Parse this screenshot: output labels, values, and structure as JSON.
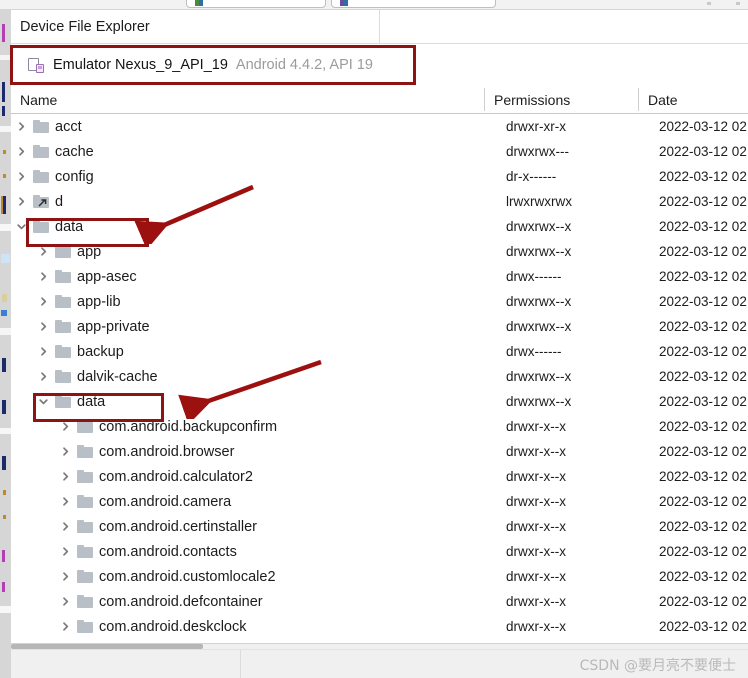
{
  "toolbar": {
    "combo_left_icon": "run-config-icon",
    "combo_right_icon": "device-select-icon"
  },
  "panel": {
    "title": "Device File Explorer"
  },
  "device": {
    "icon": "android-device-icon",
    "name": "Emulator Nexus_9_API_19",
    "details": "Android 4.4.2, API 19"
  },
  "columns": {
    "name": "Name",
    "permissions": "Permissions",
    "date": "Date"
  },
  "annotations": {
    "highlight_color": "#8f1313",
    "arrow_color": "#9d1010",
    "boxed_rows": [
      "data",
      "data"
    ]
  },
  "footer": {
    "watermark": "CSDN @要月亮不要便士"
  },
  "rows": [
    {
      "name": "acct",
      "indent": 0,
      "state": "collapsed",
      "icon": "folder-icon",
      "permissions": "drwxr-xr-x",
      "date": "2022-03-12 02"
    },
    {
      "name": "cache",
      "indent": 0,
      "state": "collapsed",
      "icon": "folder-icon",
      "permissions": "drwxrwx---",
      "date": "2022-03-12 02"
    },
    {
      "name": "config",
      "indent": 0,
      "state": "collapsed",
      "icon": "folder-icon",
      "permissions": "dr-x------",
      "date": "2022-03-12 02"
    },
    {
      "name": "d",
      "indent": 0,
      "state": "collapsed",
      "icon": "folder-link-icon",
      "permissions": "lrwxrwxrwx",
      "date": "2022-03-12 02"
    },
    {
      "name": "data",
      "indent": 0,
      "state": "expanded",
      "icon": "folder-icon",
      "permissions": "drwxrwx--x",
      "date": "2022-03-12 02"
    },
    {
      "name": "app",
      "indent": 1,
      "state": "collapsed",
      "icon": "folder-icon",
      "permissions": "drwxrwx--x",
      "date": "2022-03-12 02"
    },
    {
      "name": "app-asec",
      "indent": 1,
      "state": "collapsed",
      "icon": "folder-icon",
      "permissions": "drwx------",
      "date": "2022-03-12 02"
    },
    {
      "name": "app-lib",
      "indent": 1,
      "state": "collapsed",
      "icon": "folder-icon",
      "permissions": "drwxrwx--x",
      "date": "2022-03-12 02"
    },
    {
      "name": "app-private",
      "indent": 1,
      "state": "collapsed",
      "icon": "folder-icon",
      "permissions": "drwxrwx--x",
      "date": "2022-03-12 02"
    },
    {
      "name": "backup",
      "indent": 1,
      "state": "collapsed",
      "icon": "folder-icon",
      "permissions": "drwx------",
      "date": "2022-03-12 02"
    },
    {
      "name": "dalvik-cache",
      "indent": 1,
      "state": "collapsed",
      "icon": "folder-icon",
      "permissions": "drwxrwx--x",
      "date": "2022-03-12 02"
    },
    {
      "name": "data",
      "indent": 1,
      "state": "expanded",
      "icon": "folder-icon",
      "permissions": "drwxrwx--x",
      "date": "2022-03-12 02"
    },
    {
      "name": "com.android.backupconfirm",
      "indent": 2,
      "state": "collapsed",
      "icon": "folder-icon",
      "permissions": "drwxr-x--x",
      "date": "2022-03-12 02"
    },
    {
      "name": "com.android.browser",
      "indent": 2,
      "state": "collapsed",
      "icon": "folder-icon",
      "permissions": "drwxr-x--x",
      "date": "2022-03-12 02"
    },
    {
      "name": "com.android.calculator2",
      "indent": 2,
      "state": "collapsed",
      "icon": "folder-icon",
      "permissions": "drwxr-x--x",
      "date": "2022-03-12 02"
    },
    {
      "name": "com.android.camera",
      "indent": 2,
      "state": "collapsed",
      "icon": "folder-icon",
      "permissions": "drwxr-x--x",
      "date": "2022-03-12 02"
    },
    {
      "name": "com.android.certinstaller",
      "indent": 2,
      "state": "collapsed",
      "icon": "folder-icon",
      "permissions": "drwxr-x--x",
      "date": "2022-03-12 02"
    },
    {
      "name": "com.android.contacts",
      "indent": 2,
      "state": "collapsed",
      "icon": "folder-icon",
      "permissions": "drwxr-x--x",
      "date": "2022-03-12 02"
    },
    {
      "name": "com.android.customlocale2",
      "indent": 2,
      "state": "collapsed",
      "icon": "folder-icon",
      "permissions": "drwxr-x--x",
      "date": "2022-03-12 02"
    },
    {
      "name": "com.android.defcontainer",
      "indent": 2,
      "state": "collapsed",
      "icon": "folder-icon",
      "permissions": "drwxr-x--x",
      "date": "2022-03-12 02"
    },
    {
      "name": "com.android.deskclock",
      "indent": 2,
      "state": "collapsed",
      "icon": "folder-icon",
      "permissions": "drwxr-x--x",
      "date": "2022-03-12 02"
    }
  ]
}
